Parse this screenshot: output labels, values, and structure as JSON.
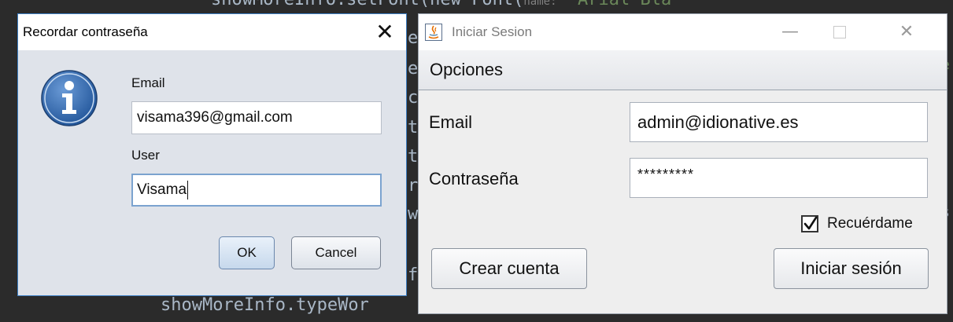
{
  "editor": {
    "line_top": "showMoreInfo.setFont(new Font(",
    "line_top_hint": "name:",
    "line_top_str": "\"Arial Bla",
    "line_bottom": "showMoreInfo.typeWor",
    "gutter_chars": [
      "e",
      "e",
      "c",
      "t",
      "t",
      "r",
      "w",
      "f"
    ],
    "right_frag_1": "e",
    "right_frag_2": "s"
  },
  "recover_dialog": {
    "title": "Recordar contraseña",
    "email_label": "Email",
    "email_value": "visama396@gmail.com",
    "user_label": "User",
    "user_value": "Visama",
    "ok_label": "OK",
    "cancel_label": "Cancel",
    "icon": "info-icon"
  },
  "login_window": {
    "title": "Iniciar Sesion",
    "menu": [
      "Opciones"
    ],
    "email_label": "Email",
    "email_value": "admin@idionative.es",
    "password_label": "Contraseña",
    "password_value": "*********",
    "remember_label": "Recuérdame",
    "remember_checked": true,
    "create_account_label": "Crear cuenta",
    "login_label": "Iniciar sesión"
  },
  "colors": {
    "editor_bg": "#2b2b2b",
    "dialog_bg": "#dfe3ea",
    "window_bg": "#eeeeee",
    "accent_border": "#3d7fc4"
  }
}
